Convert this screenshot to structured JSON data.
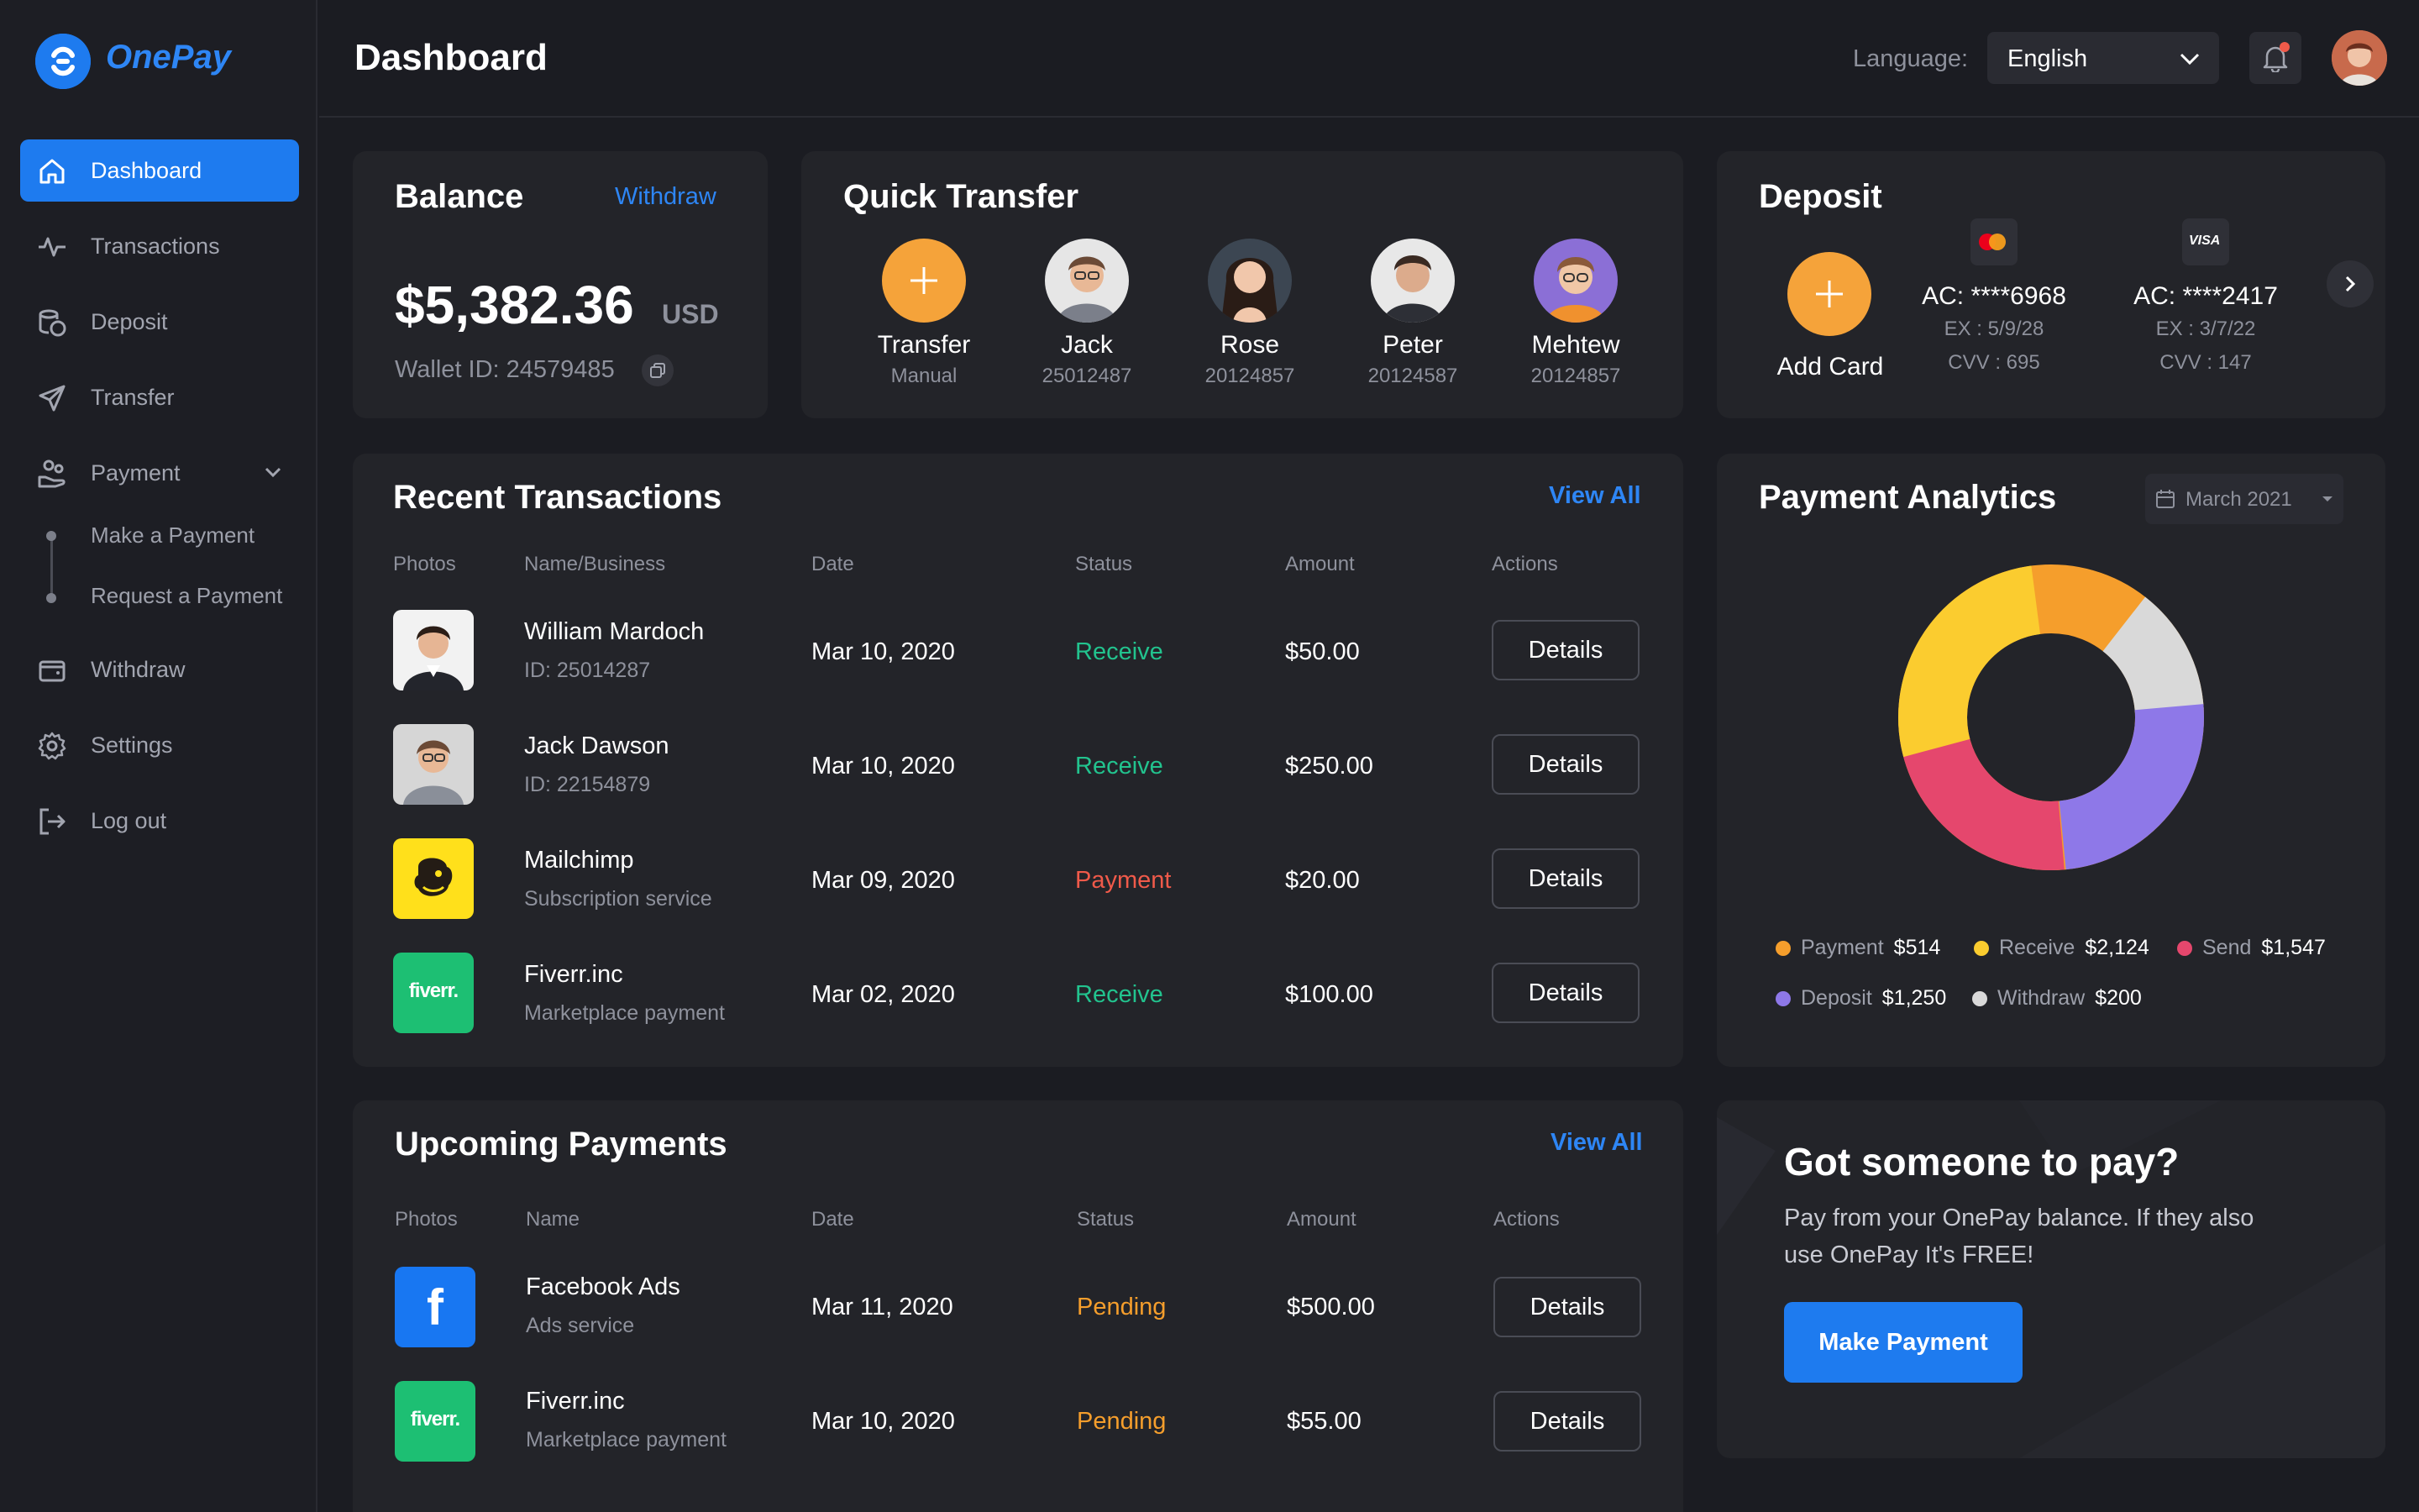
{
  "app": {
    "name": "OnePay"
  },
  "sidebar": {
    "items": [
      {
        "label": "Dashboard",
        "icon": "home-icon"
      },
      {
        "label": "Transactions",
        "icon": "pulse-icon"
      },
      {
        "label": "Deposit",
        "icon": "coins-icon"
      },
      {
        "label": "Transfer",
        "icon": "send-icon"
      },
      {
        "label": "Payment",
        "icon": "hand-coins-icon"
      },
      {
        "label": "Withdraw",
        "icon": "wallet-icon"
      },
      {
        "label": "Settings",
        "icon": "gear-icon"
      },
      {
        "label": "Log out",
        "icon": "logout-icon"
      }
    ],
    "payment_sub": [
      "Make a Payment",
      "Request a Payment"
    ]
  },
  "header": {
    "title": "Dashboard",
    "language_label": "Language:",
    "language_value": "English"
  },
  "balance": {
    "title": "Balance",
    "withdraw": "Withdraw",
    "amount": "$5,382.36",
    "currency": "USD",
    "wallet": "Wallet ID: 24579485"
  },
  "quick_transfer": {
    "title": "Quick Transfer",
    "people": [
      {
        "name": "Transfer",
        "sub": "Manual"
      },
      {
        "name": "Jack",
        "sub": "25012487"
      },
      {
        "name": "Rose",
        "sub": "20124857"
      },
      {
        "name": "Peter",
        "sub": "20124587"
      },
      {
        "name": "Mehtew",
        "sub": "20124857"
      }
    ]
  },
  "deposit": {
    "title": "Deposit",
    "add": "Add Card",
    "cards": [
      {
        "brand": "mastercard",
        "ac": "AC: ****6968",
        "ex": "EX : 5/9/28",
        "cvv": "CVV : 695"
      },
      {
        "brand": "VISA",
        "ac": "AC: ****2417",
        "ex": "EX : 3/7/22",
        "cvv": "CVV : 147"
      }
    ]
  },
  "recent": {
    "title": "Recent Transactions",
    "view_all": "View All",
    "columns": [
      "Photos",
      "Name/Business",
      "Date",
      "Status",
      "Amount",
      "Actions"
    ],
    "rows": [
      {
        "name": "William Mardoch",
        "sub": "ID: 25014287",
        "date": "Mar 10, 2020",
        "status": "Receive",
        "amount": "$50.00",
        "action": "Details"
      },
      {
        "name": "Jack Dawson",
        "sub": "ID: 22154879",
        "date": "Mar 10, 2020",
        "status": "Receive",
        "amount": "$250.00",
        "action": "Details"
      },
      {
        "name": "Mailchimp",
        "sub": "Subscription service",
        "date": "Mar 09, 2020",
        "status": "Payment",
        "amount": "$20.00",
        "action": "Details"
      },
      {
        "name": "Fiverr.inc",
        "sub": "Marketplace payment",
        "date": "Mar 02, 2020",
        "status": "Receive",
        "amount": "$100.00",
        "action": "Details"
      }
    ]
  },
  "upcoming": {
    "title": "Upcoming Payments",
    "view_all": "View All",
    "columns": [
      "Photos",
      "Name",
      "Date",
      "Status",
      "Amount",
      "Actions"
    ],
    "rows": [
      {
        "name": "Facebook Ads",
        "sub": "Ads service",
        "date": "Mar 11, 2020",
        "status": "Pending",
        "amount": "$500.00",
        "action": "Details"
      },
      {
        "name": "Fiverr.inc",
        "sub": "Marketplace payment",
        "date": "Mar 10, 2020",
        "status": "Pending",
        "amount": "$55.00",
        "action": "Details"
      }
    ]
  },
  "analytics": {
    "title": "Payment Analytics",
    "month": "March 2021",
    "legend": [
      {
        "label": "Payment",
        "value": "$514",
        "color": "#f59e2c"
      },
      {
        "label": "Receive",
        "value": "$2,124",
        "color": "#fbcc2f"
      },
      {
        "label": "Send",
        "value": "$1,547",
        "color": "#e5476d"
      },
      {
        "label": "Deposit",
        "value": "$1,250",
        "color": "#8e78e8"
      },
      {
        "label": "Withdraw",
        "value": "$200",
        "color": "#d9d9d9"
      }
    ]
  },
  "promo": {
    "title": "Got someone to pay?",
    "text1": "Pay from your OnePay balance. If they also",
    "text2": "use OnePay It's FREE!",
    "button": "Make Payment"
  },
  "logos": {
    "mailchimp": "mailchimp-logo",
    "fiverr": "fiverr.",
    "facebook": "f"
  },
  "colors": {
    "accent": "#1e7bef",
    "receive": "#22c38e",
    "payment": "#f05a4a",
    "pending": "#f59e2c",
    "orange": "#f5a33a"
  }
}
